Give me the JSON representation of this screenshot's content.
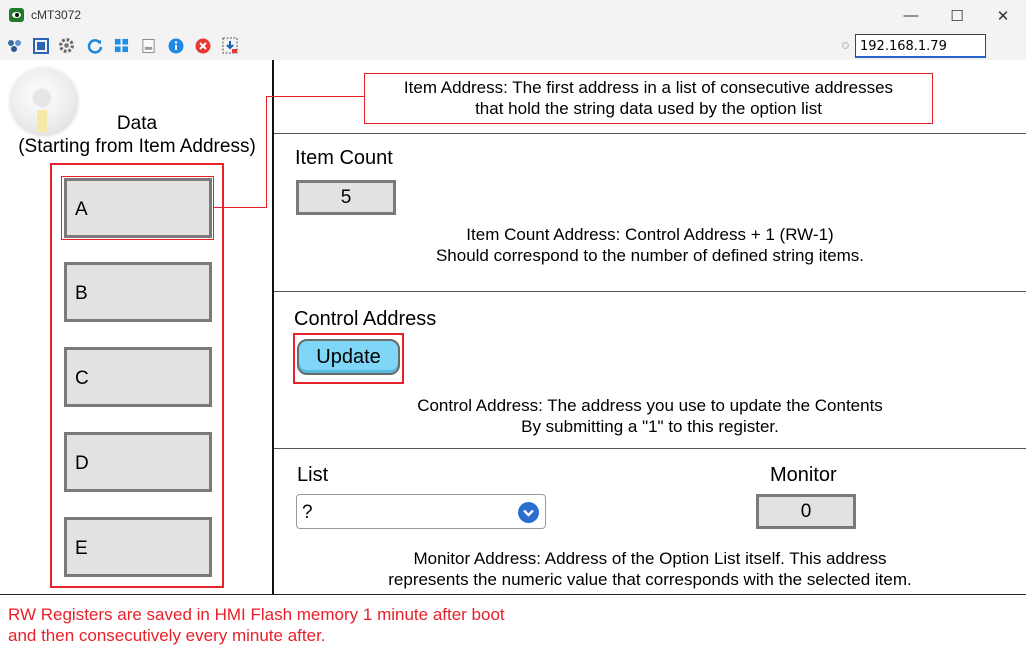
{
  "window": {
    "title": "cMT3072",
    "minimize": "—",
    "maximize": "☐",
    "close": "✕"
  },
  "toolbar": {
    "icons": [
      "network-icon",
      "fullscreen-icon",
      "settings-gear-icon",
      "refresh-icon",
      "windows-icon",
      "document-icon",
      "info-icon",
      "stop-icon",
      "download-icon"
    ],
    "ip_address": "192.168.1.79"
  },
  "left_panel": {
    "title_line1": "Data",
    "title_line2": "(Starting from Item Address)",
    "items": [
      "A",
      "B",
      "C",
      "D",
      "E"
    ]
  },
  "item_address": {
    "line1": "Item Address: The first address in a list of consecutive addresses",
    "line2": "that hold the string data used by the option list"
  },
  "item_count": {
    "label": "Item Count",
    "value": "5",
    "desc_line1": "Item Count Address: Control Address + 1 (RW-1)",
    "desc_line2": "Should correspond to the number of defined string items."
  },
  "control_address": {
    "label": "Control Address",
    "button": "Update",
    "desc_line1": "Control Address: The address you use to update the Contents",
    "desc_line2": "By submitting a \"1\" to this register."
  },
  "list": {
    "label": "List",
    "selected": "?",
    "monitor_label": "Monitor",
    "monitor_value": "0",
    "desc_line1": "Monitor Address: Address of the Option List itself. This address",
    "desc_line2": "represents the numeric value that corresponds with the selected item."
  },
  "footer": {
    "line1": "RW Registers are saved in HMI Flash memory 1 minute after boot",
    "line2": "and then consecutively every minute after."
  },
  "colors": {
    "annotation_red": "#e8202a",
    "button_blue": "#7fd6f7",
    "field_gray": "#e2e2e2"
  }
}
